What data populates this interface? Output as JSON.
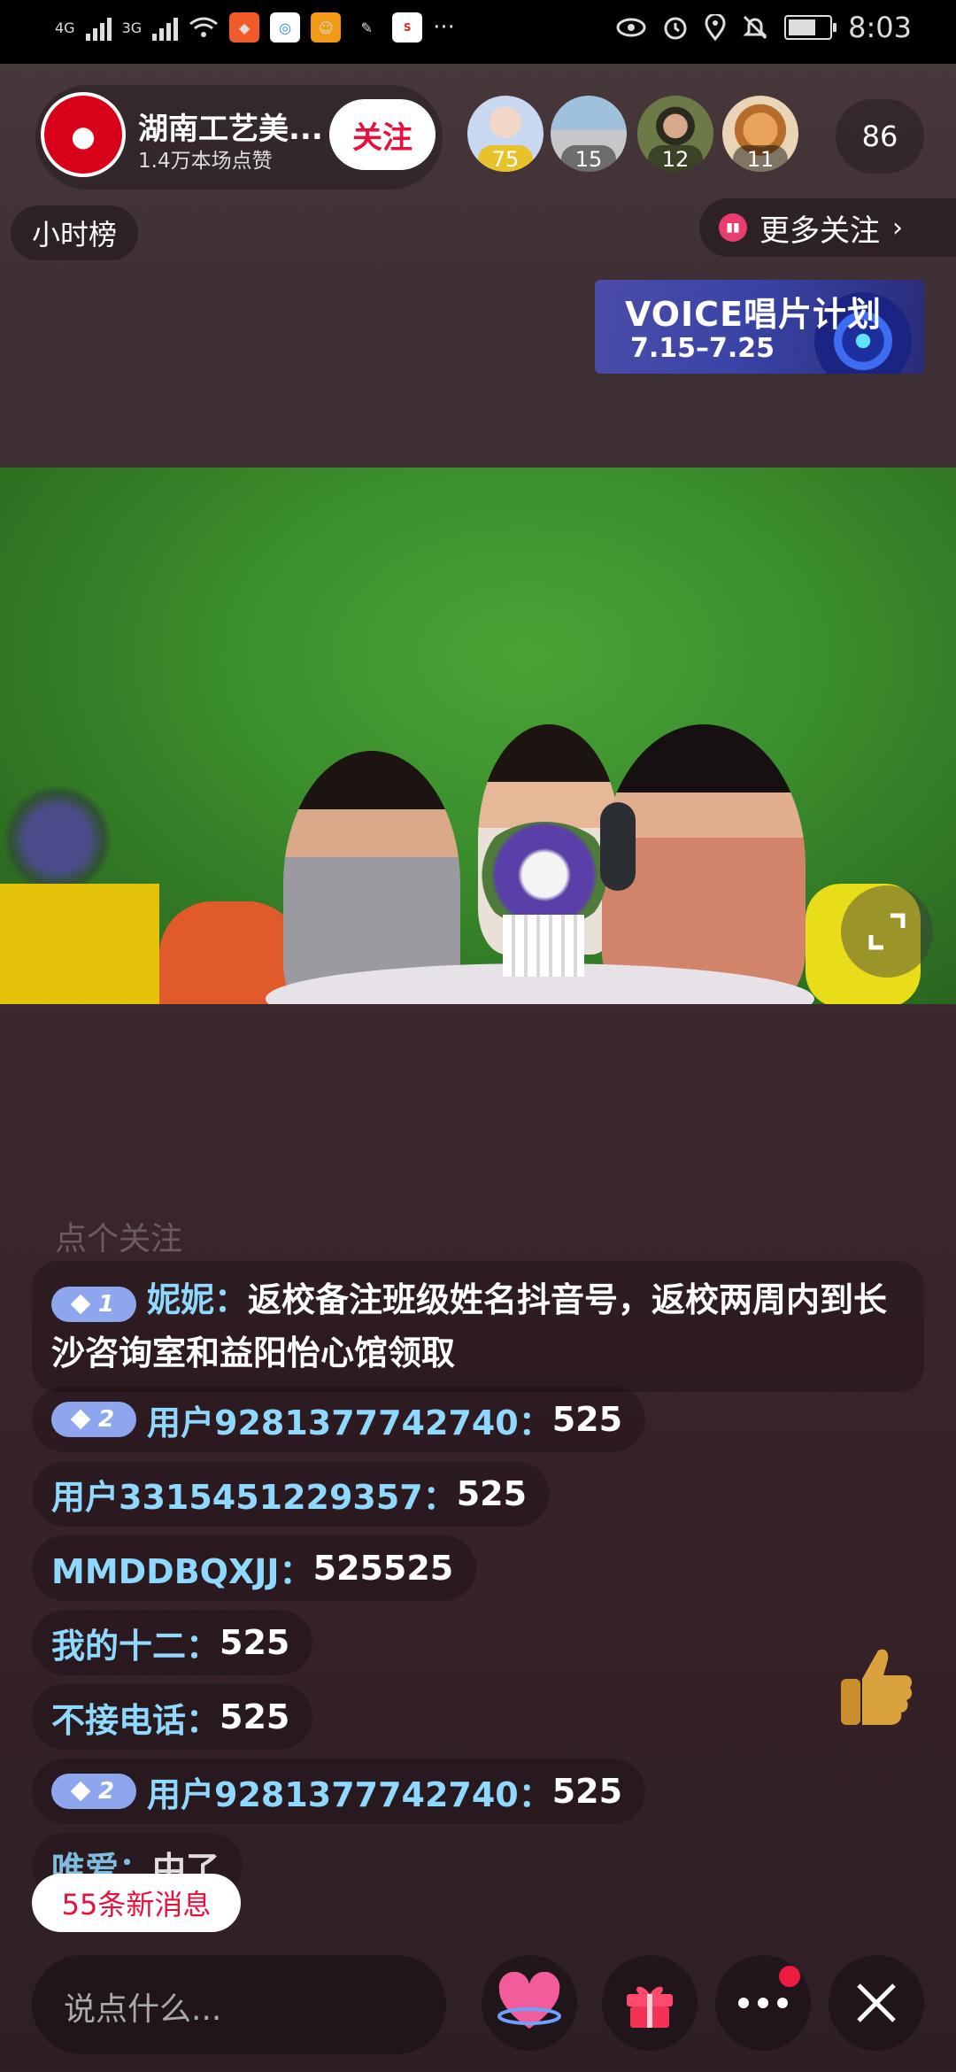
{
  "status_bar": {
    "network_1": "4G",
    "network_2": "3G",
    "time": "8:03",
    "icons": [
      "signal-icon",
      "wifi-icon",
      "app-icon",
      "eye-icon",
      "alarm-icon",
      "location-icon",
      "mute-icon",
      "battery-icon"
    ]
  },
  "header": {
    "anchor_name": "湖南工艺美...",
    "likes": "1.4万本场点赞",
    "follow_label": "关注",
    "viewers": [
      {
        "badge": "75"
      },
      {
        "badge": "15"
      },
      {
        "badge": "12"
      },
      {
        "badge": "11"
      }
    ],
    "viewer_count": "86",
    "hour_rank": "小时榜",
    "more_follow": "更多关注"
  },
  "banner": {
    "title": "VOICE唱片计划",
    "dates": "7.15–7.25"
  },
  "chat": {
    "faded": "点个关注",
    "messages": [
      {
        "level": "1",
        "user": "妮妮：",
        "text": "返校备注班级姓名抖音号，返校两周内到长沙咨询室和益阳怡心馆领取"
      },
      {
        "level": "2",
        "user": "用户9281377742740：",
        "text": "525"
      },
      {
        "level": "",
        "user": "用户3315451229357：",
        "text": "525"
      },
      {
        "level": "",
        "user": "MMDDBQXJJ：",
        "text": "525525"
      },
      {
        "level": "",
        "user": "我的十二：",
        "text": "525"
      },
      {
        "level": "",
        "user": "不接电话：",
        "text": "525"
      },
      {
        "level": "2",
        "user": "用户9281377742740：",
        "text": "525"
      },
      {
        "level": "",
        "user": "唯爱：",
        "text": "中了"
      }
    ],
    "new_messages": "55条新消息"
  },
  "bottom": {
    "input_placeholder": "说点什么..."
  },
  "colors": {
    "accent_red": "#e8113d",
    "username_blue": "#8fd8ff",
    "level_badge": "#8ea6ee"
  }
}
